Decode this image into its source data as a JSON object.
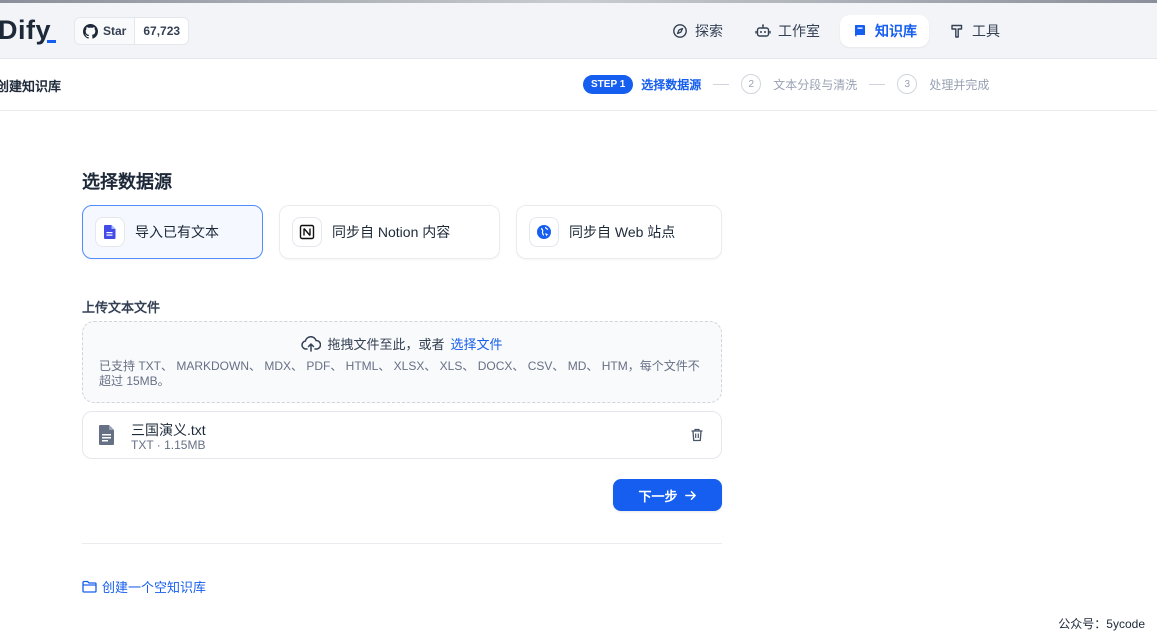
{
  "app": {
    "logo": "Dify",
    "github_star_label": "Star",
    "github_star_count": "67,723"
  },
  "nav": [
    {
      "label": "探索",
      "icon": "compass-icon",
      "active": false
    },
    {
      "label": "工作室",
      "icon": "robot-icon",
      "active": false
    },
    {
      "label": "知识库",
      "icon": "book-icon",
      "active": true
    },
    {
      "label": "工具",
      "icon": "hammer-icon",
      "active": false
    }
  ],
  "subheader": {
    "title": "创建知识库"
  },
  "steps": [
    {
      "badge": "STEP 1",
      "label": "选择数据源",
      "active": true
    },
    {
      "number": "2",
      "label": "文本分段与清洗",
      "active": false
    },
    {
      "number": "3",
      "label": "处理并完成",
      "active": false
    }
  ],
  "main": {
    "section_title": "选择数据源",
    "sources": [
      {
        "label": "导入已有文本",
        "icon": "file-text-icon",
        "active": true
      },
      {
        "label": "同步自 Notion 内容",
        "icon": "notion-icon",
        "active": false
      },
      {
        "label": "同步自 Web 站点",
        "icon": "web-icon",
        "active": false
      }
    ],
    "upload_label": "上传文本文件",
    "dropzone": {
      "text": "拖拽文件至此，或者",
      "link": "选择文件",
      "hint": "已支持 TXT、 MARKDOWN、 MDX、 PDF、 HTML、 XLSX、 XLS、 DOCX、 CSV、 MD、 HTM，每个文件不超过 15MB。"
    },
    "file": {
      "name": "三国演义.txt",
      "meta": "TXT · 1.15MB"
    },
    "next_button": "下一步",
    "empty_kb_link": "创建一个空知识库"
  },
  "watermark": "公众号：5ycode",
  "colors": {
    "accent": "#155eef",
    "background": "#ffffff",
    "header_bg": "#f2f4f7"
  }
}
